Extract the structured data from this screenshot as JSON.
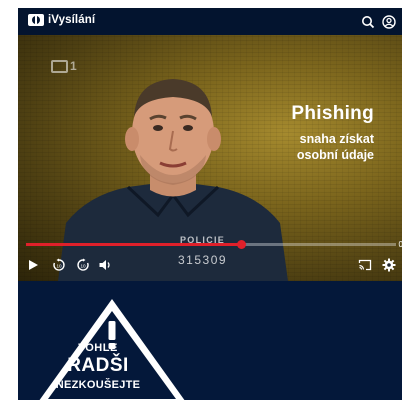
{
  "header": {
    "brand": "iVysílání",
    "search_icon": "search-icon",
    "account_icon": "account-icon"
  },
  "video": {
    "channel_logo": "1",
    "caption_title": "Phishing",
    "caption_line1": "snaha získat",
    "caption_line2": "osobní údaje",
    "badge_text": "POLICIE",
    "badge_number": "315309",
    "time_display": "0",
    "progress": 0.58
  },
  "controls": {
    "play_icon": "play-icon",
    "rewind_icon": "rewind-10-icon",
    "forward_icon": "forward-10-icon",
    "volume_icon": "volume-icon",
    "cast_icon": "cast-icon",
    "settings_icon": "settings-icon"
  },
  "warning": {
    "line1": "TOHLE",
    "line2": "RADŠI",
    "line3": "NEZKOUŠEJTE"
  },
  "colors": {
    "app_bg": "#04183a",
    "accent_red": "#e0202a"
  }
}
